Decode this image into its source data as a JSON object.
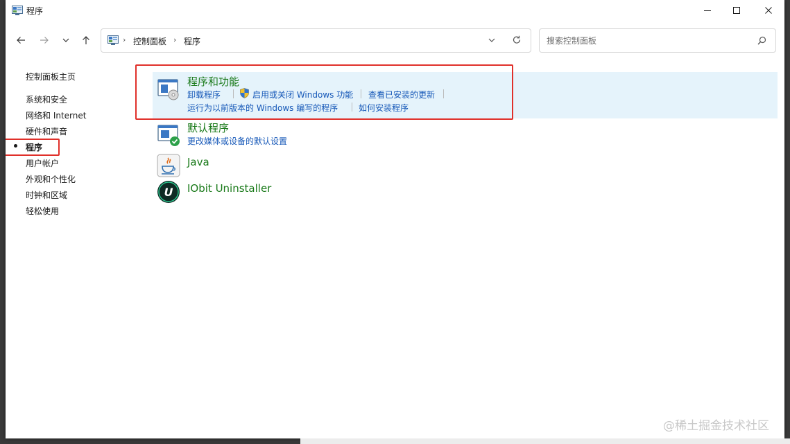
{
  "window": {
    "title": "程序",
    "minimize_icon": "minimize-icon",
    "maximize_icon": "maximize-icon",
    "close_icon": "close-icon"
  },
  "nav": {
    "back_icon": "arrow-left-icon",
    "forward_icon": "arrow-right-icon",
    "recent_icon": "chevron-down-icon",
    "up_icon": "arrow-up-icon",
    "breadcrumbs": [
      "控制面板",
      "程序"
    ],
    "refresh_icon": "refresh-icon"
  },
  "search": {
    "placeholder": "搜索控制面板",
    "value": ""
  },
  "sidebar": {
    "home": "控制面板主页",
    "items": [
      {
        "label": "系统和安全",
        "current": false
      },
      {
        "label": "网络和 Internet",
        "current": false
      },
      {
        "label": "硬件和声音",
        "current": false
      },
      {
        "label": "程序",
        "current": true
      },
      {
        "label": "用户帐户",
        "current": false
      },
      {
        "label": "外观和个性化",
        "current": false
      },
      {
        "label": "时钟和区域",
        "current": false
      },
      {
        "label": "轻松使用",
        "current": false
      }
    ]
  },
  "categories": [
    {
      "title": "程序和功能",
      "icon": "programs-features-icon",
      "links_row1": [
        "卸载程序",
        "启用或关闭 Windows 功能",
        "查看已安装的更新"
      ],
      "links_row2": [
        "运行为以前版本的 Windows 编写的程序",
        "如何安装程序"
      ],
      "shield_icon": "uac-shield-icon"
    },
    {
      "title": "默认程序",
      "icon": "default-programs-icon",
      "links_row1": [
        "更改媒体或设备的默认设置"
      ]
    },
    {
      "title": "Java",
      "icon": "java-icon"
    },
    {
      "title": "IObit Uninstaller",
      "icon": "iobit-uninstaller-icon",
      "icon_letter": "U"
    }
  ],
  "watermark": "@稀土掘金技术社区",
  "colors": {
    "link": "#1658b8",
    "category_title": "#1a7a1a",
    "highlight": "#e5f3fb",
    "annotation_red": "#e0302a"
  }
}
